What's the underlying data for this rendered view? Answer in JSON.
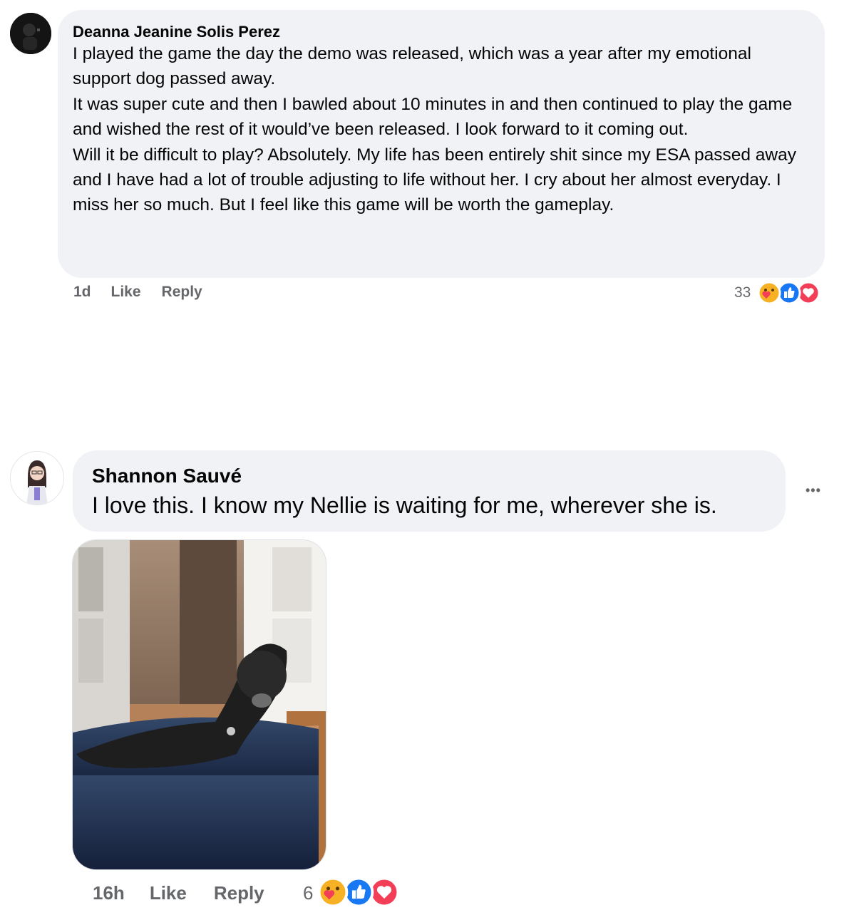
{
  "comments": [
    {
      "author": "Deanna Jeanine Solis Perez",
      "paragraphs": [
        "I played the game the day the demo was released, which was a year after my emotional support dog passed away.",
        "It was super cute and then I bawled about 10 minutes in and then continued to play the game and wished the rest of it would’ve been released. I look forward to it coming out.",
        "Will it be difficult to play? Absolutely. My life has been entirely shit since my ESA passed away and I have had a lot of trouble adjusting to life without her. I cry about her almost everyday. I miss her so much. But I feel like this game will be worth the gameplay."
      ],
      "time": "1d",
      "like_label": "Like",
      "reply_label": "Reply",
      "reaction_count": "33",
      "reaction_icons": [
        "care-icon",
        "like-icon",
        "love-icon"
      ]
    },
    {
      "author": "Shannon Sauvé",
      "text": "I love this. I know my Nellie is waiting for me, wherever she is.",
      "time": "16h",
      "like_label": "Like",
      "reply_label": "Reply",
      "reaction_count": "6",
      "reaction_icons": [
        "care-icon",
        "like-icon",
        "love-icon"
      ],
      "more_label": "•••",
      "attachment": "photo of a black dog lying on a blue leather ottoman"
    }
  ],
  "colors": {
    "bubble": "#f0f2f5",
    "meta_text": "#65676b",
    "like_blue": "#1877f2",
    "love_red": "#f33e58",
    "care_yellow": "#f7b125"
  }
}
